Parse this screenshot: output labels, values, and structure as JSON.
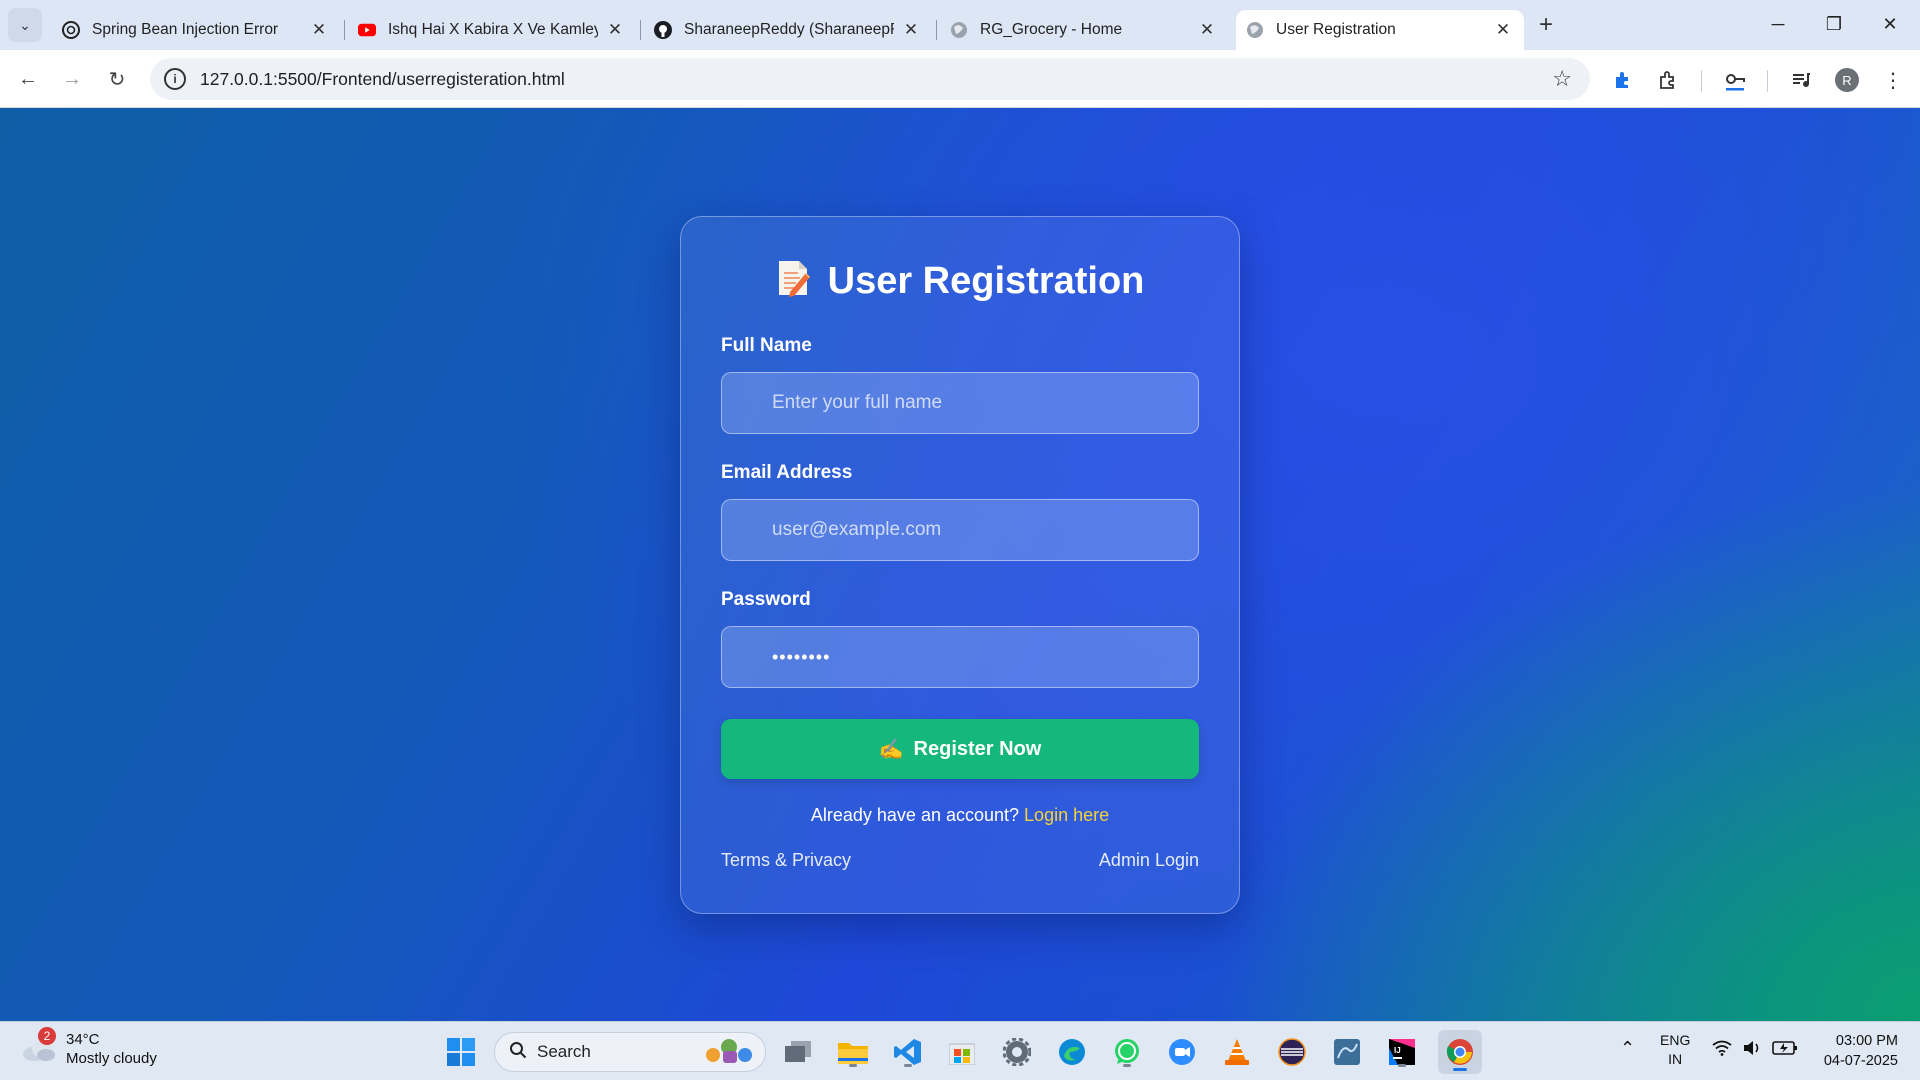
{
  "browser": {
    "tabs": [
      {
        "title": "Spring Bean Injection Error",
        "favicon": "openai-icon",
        "active": false
      },
      {
        "title": "Ishq Hai X Kabira X Ve Kamleya",
        "favicon": "youtube-icon",
        "active": false
      },
      {
        "title": "SharaneepReddy (SharaneepReddy)",
        "favicon": "github-icon",
        "active": false
      },
      {
        "title": "RG_Grocery - Home",
        "favicon": "globe-icon",
        "active": false
      },
      {
        "title": "User Registration",
        "favicon": "globe-icon",
        "active": true
      }
    ],
    "url": "127.0.0.1:5500/Frontend/userregisteration.html",
    "profile_initial": "R"
  },
  "form": {
    "title": "User Registration",
    "full_name_label": "Full Name",
    "full_name_placeholder": "Enter your full name",
    "email_label": "Email Address",
    "email_placeholder": "user@example.com",
    "password_label": "Password",
    "password_value": "••••••••",
    "submit_label": "Register Now",
    "already_text": "Already have an account?",
    "login_link": "Login here",
    "terms_link": "Terms & Privacy",
    "admin_link": "Admin Login",
    "accent_color": "#15b87c",
    "link_color": "#f3d23a"
  },
  "taskbar": {
    "weather_temp": "34°C",
    "weather_desc": "Mostly cloudy",
    "weather_badge": "2",
    "search_label": "Search",
    "lang_line1": "ENG",
    "lang_line2": "IN",
    "time": "03:00 PM",
    "date": "04-07-2025"
  }
}
